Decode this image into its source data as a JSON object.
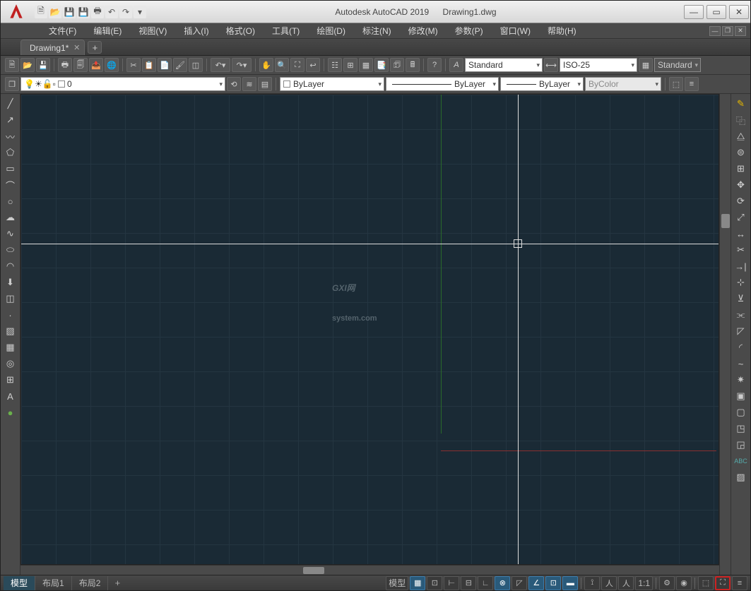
{
  "title": {
    "app": "Autodesk AutoCAD 2019",
    "file": "Drawing1.dwg"
  },
  "menu": [
    "文件(F)",
    "编辑(E)",
    "视图(V)",
    "插入(I)",
    "格式(O)",
    "工具(T)",
    "绘图(D)",
    "标注(N)",
    "修改(M)",
    "参数(P)",
    "窗口(W)",
    "帮助(H)"
  ],
  "filetab": {
    "name": "Drawing1*"
  },
  "toolbar1": {
    "text_style": "Standard",
    "dim_style": "ISO-25",
    "table_style": "Standard"
  },
  "toolbar2": {
    "layer": "0",
    "color": "ByLayer",
    "linetype": "ByLayer",
    "lineweight": "ByLayer",
    "plotstyle": "ByColor"
  },
  "layout_tabs": {
    "model": "模型",
    "l1": "布局1",
    "l2": "布局2"
  },
  "status": {
    "model": "模型",
    "scale": "1:1"
  },
  "watermark": {
    "main": "GXI网",
    "sub": "system.com"
  }
}
